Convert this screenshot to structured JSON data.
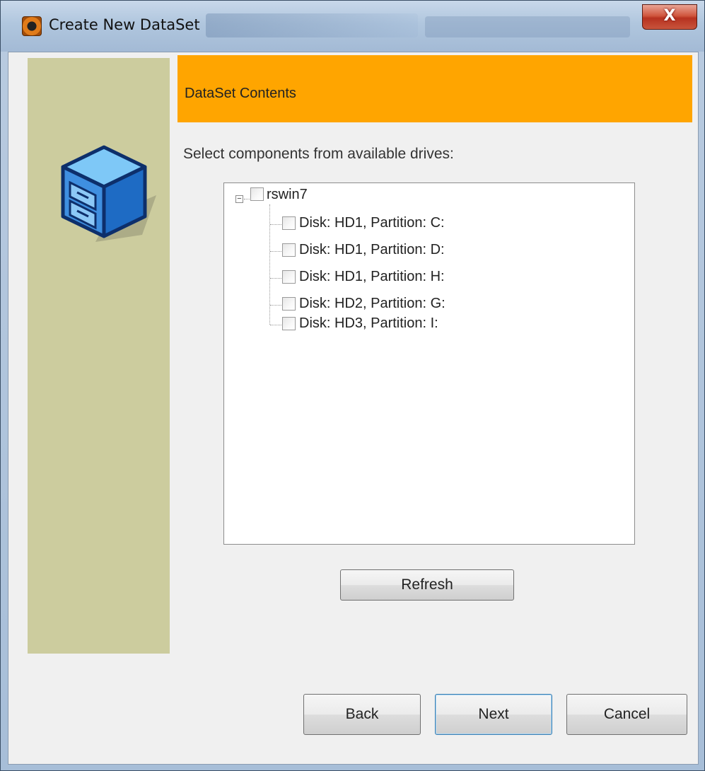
{
  "window": {
    "title": "Create New DataSet",
    "close_label": "X"
  },
  "header": {
    "title": "DataSet Contents"
  },
  "instructions": "Select components from available drives:",
  "tree": {
    "root": {
      "label": "rswin7",
      "expanded": true,
      "checked": false
    },
    "children": [
      {
        "label": "Disk: HD1, Partition: C:",
        "checked": false
      },
      {
        "label": "Disk: HD1, Partition: D:",
        "checked": false
      },
      {
        "label": "Disk: HD1, Partition: H:",
        "checked": false
      },
      {
        "label": "Disk: HD2, Partition: G:",
        "checked": false
      },
      {
        "label": "Disk: HD3, Partition: I:",
        "checked": false
      }
    ]
  },
  "buttons": {
    "refresh": "Refresh",
    "back": "Back",
    "next": "Next",
    "cancel": "Cancel"
  },
  "icons": {
    "app": "app-icon",
    "wizard": "cabinet-cube-icon",
    "expander": "collapse-icon"
  },
  "colors": {
    "header_band": "#ffa500",
    "side_panel": "#cccc9e"
  }
}
